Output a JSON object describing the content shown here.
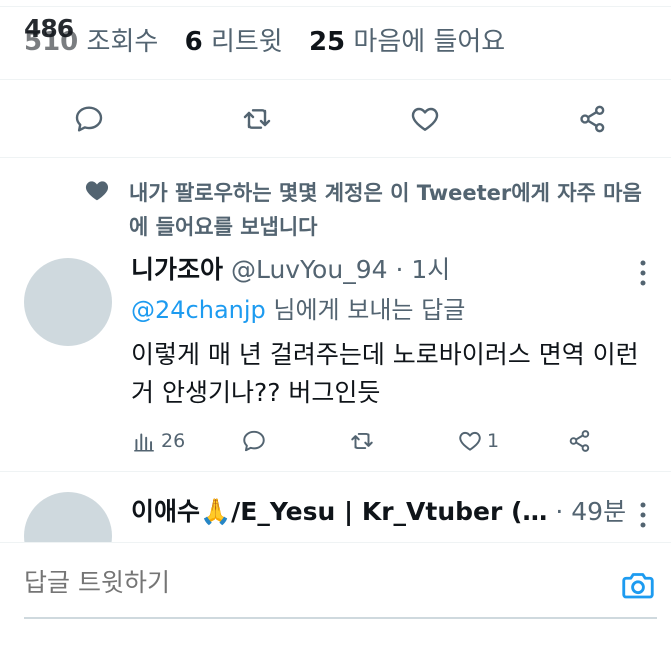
{
  "stats": {
    "glitch_overlay": "486",
    "views_count": "510",
    "views_label": "조회수",
    "retweets_count": "6",
    "retweets_label": "리트윗",
    "likes_count": "25",
    "likes_label": "마음에 들어요"
  },
  "actions": {
    "reply_icon": "reply-icon",
    "retweet_icon": "retweet-icon",
    "like_icon": "heart-icon",
    "share_icon": "share-icon"
  },
  "social_context": {
    "text": "내가 팔로우하는 몇몇 계정은 이 Tweeter에게 자주 마음에 들어요를 보냅니다"
  },
  "reply": {
    "display_name": "니가조아",
    "meta": "@LuvYou_94 · 1시",
    "reply_mention": "@24chanjp",
    "reply_suffix": " 님에게 보내는 답글",
    "body": "이렇게 매 년 걸려주는데 노로바이러스 면역 이런거 안생기나?? 버그인듯",
    "views": "26",
    "likes": "1"
  },
  "reply2": {
    "display_name": "이애수🙏/E_Yesu | Kr_Vtuber (…",
    "meta": " · 49분"
  },
  "compose": {
    "placeholder": "답글 트윗하기"
  },
  "colors": {
    "accent": "#1d9bf0",
    "text_primary": "#0f1419",
    "text_secondary": "#536471",
    "divider": "#eff3f4",
    "avatar_placeholder": "#cfd9de"
  }
}
